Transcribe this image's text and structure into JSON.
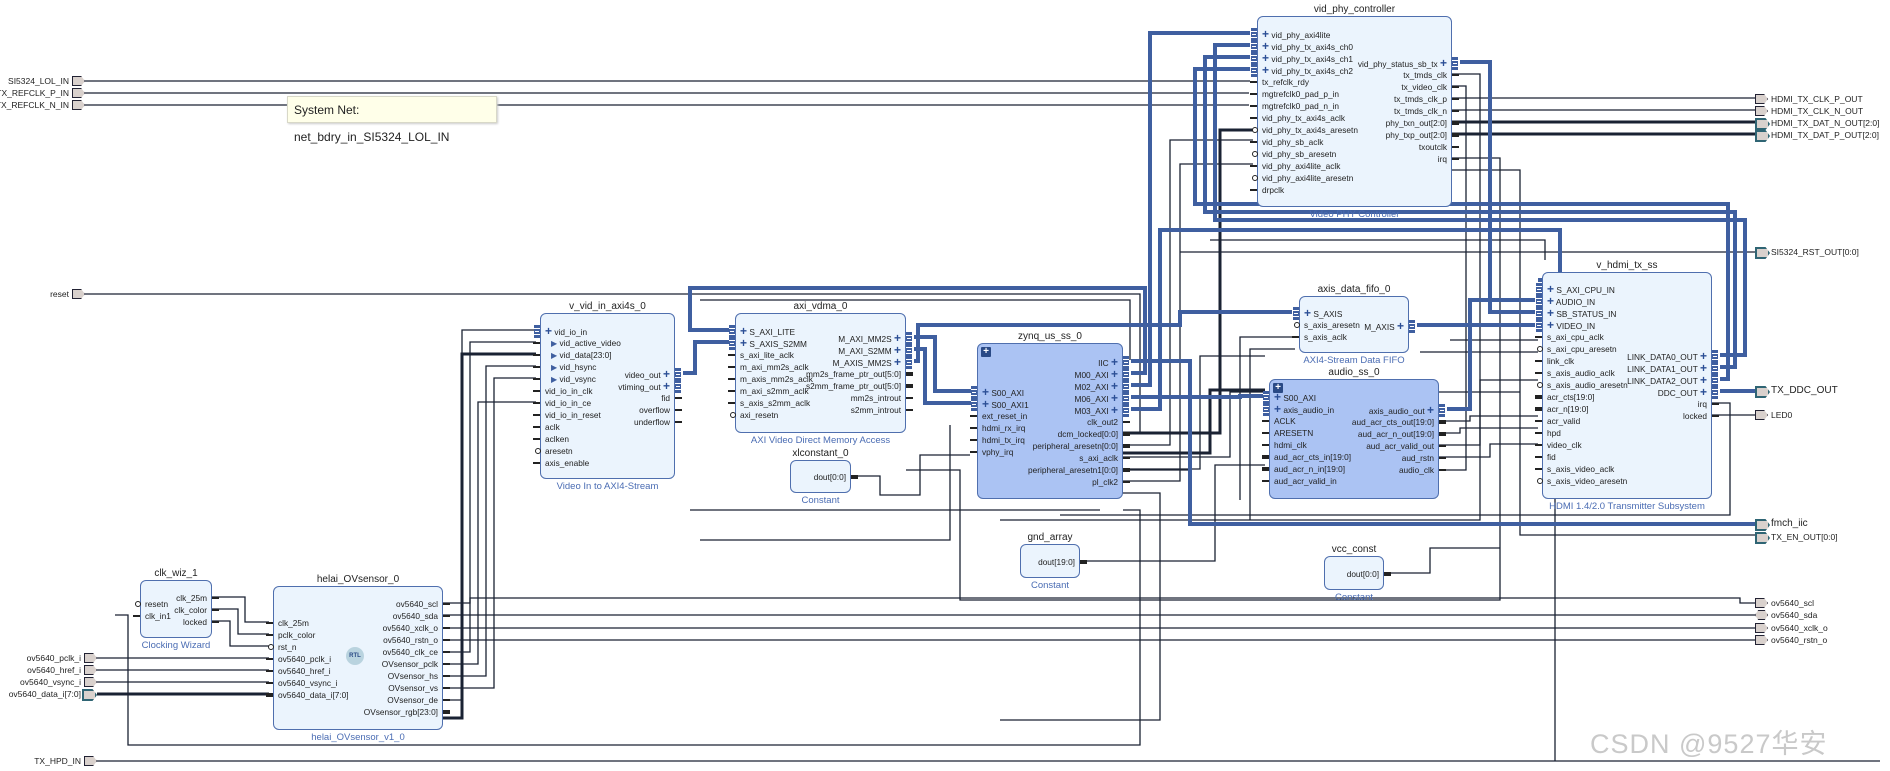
{
  "tooltip": "System Net: net_bdry_in_SI5324_LOL_IN",
  "watermark": "CSDN @9527华安",
  "colors": {
    "interface_wire": "#3f5fa0",
    "wire": "#1a2233",
    "block_fill": "#ebf4fd",
    "hier_fill": "#abc3f3",
    "subtitle": "#4a6cb3"
  },
  "ports_left": [
    {
      "label": "SI5324_LOL_IN",
      "kind": "wire"
    },
    {
      "label": "TX_REFCLK_P_IN",
      "kind": "wire"
    },
    {
      "label": "TX_REFCLK_N_IN",
      "kind": "wire"
    },
    {
      "label": "reset",
      "kind": "wire"
    },
    {
      "label": "ov5640_pclk_i",
      "kind": "wire"
    },
    {
      "label": "ov5640_href_i",
      "kind": "wire"
    },
    {
      "label": "ov5640_vsync_i",
      "kind": "wire"
    },
    {
      "label": "ov5640_data_i[7:0]",
      "kind": "bus"
    },
    {
      "label": "TX_HPD_IN",
      "kind": "wire"
    }
  ],
  "ports_right": [
    {
      "label": "HDMI_TX_CLK_P_OUT",
      "kind": "wire"
    },
    {
      "label": "HDMI_TX_CLK_N_OUT",
      "kind": "wire"
    },
    {
      "label": "HDMI_TX_DAT_N_OUT[2:0]",
      "kind": "bus"
    },
    {
      "label": "HDMI_TX_DAT_P_OUT[2:0]",
      "kind": "bus"
    },
    {
      "label": "SI5324_RST_OUT[0:0]",
      "kind": "bus"
    },
    {
      "label": "TX_DDC_OUT",
      "kind": "intf"
    },
    {
      "label": "LED0",
      "kind": "wire"
    },
    {
      "label": "fmch_iic",
      "kind": "intf"
    },
    {
      "label": "TX_EN_OUT[0:0]",
      "kind": "bus"
    },
    {
      "label": "ov5640_scl",
      "kind": "wire"
    },
    {
      "label": "ov5640_sda",
      "kind": "bidir"
    },
    {
      "label": "ov5640_xclk_o",
      "kind": "wire"
    },
    {
      "label": "ov5640_rstn_o",
      "kind": "wire"
    }
  ],
  "blocks": [
    {
      "id": "vphy",
      "title": "vid_phy_controller",
      "subtitle": "Video PHY Controller",
      "left": [
        [
          "vid_phy_axi4lite",
          "i"
        ],
        [
          "vid_phy_tx_axi4s_ch0",
          "i"
        ],
        [
          "vid_phy_tx_axi4s_ch1",
          "i"
        ],
        [
          "vid_phy_tx_axi4s_ch2",
          "i"
        ],
        [
          "tx_refclk_rdy",
          "w"
        ],
        [
          "mgtrefclk0_pad_p_in",
          "w"
        ],
        [
          "mgtrefclk0_pad_n_in",
          "w"
        ],
        [
          "vid_phy_tx_axi4s_aclk",
          "w"
        ],
        [
          "vid_phy_tx_axi4s_aresetn",
          "r"
        ],
        [
          "vid_phy_sb_aclk",
          "w"
        ],
        [
          "vid_phy_sb_aresetn",
          "r"
        ],
        [
          "vid_phy_axi4lite_aclk",
          "w"
        ],
        [
          "vid_phy_axi4lite_aresetn",
          "r"
        ],
        [
          "drpclk",
          "w"
        ]
      ],
      "right": [
        [
          "vid_phy_status_sb_tx",
          "i"
        ],
        [
          "tx_tmds_clk",
          "w"
        ],
        [
          "tx_video_clk",
          "w"
        ],
        [
          "tx_tmds_clk_p",
          "w"
        ],
        [
          "tx_tmds_clk_n",
          "w"
        ],
        [
          "phy_txn_out[2:0]",
          "b"
        ],
        [
          "phy_txp_out[2:0]",
          "b"
        ],
        [
          "txoutclk",
          "w"
        ],
        [
          "irq",
          "w"
        ]
      ]
    },
    {
      "id": "vin",
      "title": "v_vid_in_axi4s_0",
      "subtitle": "Video In to AXI4-Stream",
      "left": [
        [
          "vid_io_in",
          "i"
        ],
        [
          "vid_active_video",
          "s"
        ],
        [
          "vid_data[23:0]",
          "s"
        ],
        [
          "vid_hsync",
          "s"
        ],
        [
          "vid_vsync",
          "s"
        ],
        [
          "vid_io_in_clk",
          "w"
        ],
        [
          "vid_io_in_ce",
          "w"
        ],
        [
          "vid_io_in_reset",
          "w"
        ],
        [
          "aclk",
          "w"
        ],
        [
          "aclken",
          "w"
        ],
        [
          "aresetn",
          "r"
        ],
        [
          "axis_enable",
          "w"
        ]
      ],
      "right": [
        [
          "video_out",
          "i"
        ],
        [
          "vtiming_out",
          "i"
        ],
        [
          "fid",
          "w"
        ],
        [
          "overflow",
          "w"
        ],
        [
          "underflow",
          "w"
        ]
      ]
    },
    {
      "id": "vdma",
      "title": "axi_vdma_0",
      "subtitle": "AXI Video Direct Memory Access",
      "left": [
        [
          "S_AXI_LITE",
          "i"
        ],
        [
          "S_AXIS_S2MM",
          "i"
        ],
        [
          "s_axi_lite_aclk",
          "w"
        ],
        [
          "m_axi_mm2s_aclk",
          "w"
        ],
        [
          "m_axis_mm2s_aclk",
          "w"
        ],
        [
          "m_axi_s2mm_aclk",
          "w"
        ],
        [
          "s_axis_s2mm_aclk",
          "w"
        ],
        [
          "axi_resetn",
          "r"
        ]
      ],
      "right": [
        [
          "M_AXI_MM2S",
          "i"
        ],
        [
          "M_AXI_S2MM",
          "i"
        ],
        [
          "M_AXIS_MM2S",
          "i"
        ],
        [
          "mm2s_frame_ptr_out[5:0]",
          "b"
        ],
        [
          "s2mm_frame_ptr_out[5:0]",
          "b"
        ],
        [
          "mm2s_introut",
          "w"
        ],
        [
          "s2mm_introut",
          "w"
        ]
      ]
    },
    {
      "id": "zynq",
      "title": "zynq_us_ss_0",
      "subtitle": "",
      "left": [
        [
          "S00_AXI",
          "i"
        ],
        [
          "S00_AXI1",
          "i"
        ],
        [
          "ext_reset_in",
          "w"
        ],
        [
          "hdmi_rx_irq",
          "w"
        ],
        [
          "hdmi_tx_irq",
          "w"
        ],
        [
          "vphy_irq",
          "w"
        ]
      ],
      "right": [
        [
          "IIC",
          "i"
        ],
        [
          "M00_AXI",
          "i"
        ],
        [
          "M02_AXI",
          "i"
        ],
        [
          "M06_AXI",
          "i"
        ],
        [
          "M03_AXI",
          "i"
        ],
        [
          "clk_out2",
          "w"
        ],
        [
          "dcm_locked[0:0]",
          "b"
        ],
        [
          "peripheral_aresetn[0:0]",
          "b"
        ],
        [
          "s_axi_aclk",
          "w"
        ],
        [
          "peripheral_aresetn1[0:0]",
          "b"
        ],
        [
          "pl_clk2",
          "w"
        ]
      ]
    },
    {
      "id": "audio",
      "title": "audio_ss_0",
      "subtitle": "",
      "left": [
        [
          "S00_AXI",
          "i"
        ],
        [
          "axis_audio_in",
          "i"
        ],
        [
          "ACLK",
          "w"
        ],
        [
          "ARESETN",
          "w"
        ],
        [
          "hdmi_clk",
          "w"
        ],
        [
          "aud_acr_cts_in[19:0]",
          "b"
        ],
        [
          "aud_acr_n_in[19:0]",
          "b"
        ],
        [
          "aud_acr_valid_in",
          "w"
        ]
      ],
      "right": [
        [
          "axis_audio_out",
          "i"
        ],
        [
          "aud_acr_cts_out[19:0]",
          "b"
        ],
        [
          "aud_acr_n_out[19:0]",
          "b"
        ],
        [
          "aud_acr_valid_out",
          "w"
        ],
        [
          "aud_rstn",
          "w"
        ],
        [
          "audio_clk",
          "w"
        ]
      ]
    },
    {
      "id": "fifo",
      "title": "axis_data_fifo_0",
      "subtitle": "AXI4-Stream Data FIFO",
      "left": [
        [
          "S_AXIS",
          "i"
        ],
        [
          "s_axis_aresetn",
          "r"
        ],
        [
          "s_axis_aclk",
          "w"
        ]
      ],
      "right": [
        [
          "M_AXIS",
          "i"
        ]
      ]
    },
    {
      "id": "hdmi",
      "title": "v_hdmi_tx_ss",
      "subtitle": "HDMI 1.4/2.0 Transmitter Subsystem",
      "left": [
        [
          "S_AXI_CPU_IN",
          "i"
        ],
        [
          "AUDIO_IN",
          "i"
        ],
        [
          "SB_STATUS_IN",
          "i"
        ],
        [
          "VIDEO_IN",
          "i"
        ],
        [
          "s_axi_cpu_aclk",
          "w"
        ],
        [
          "s_axi_cpu_aresetn",
          "r"
        ],
        [
          "link_clk",
          "w"
        ],
        [
          "s_axis_audio_aclk",
          "w"
        ],
        [
          "s_axis_audio_aresetn",
          "r"
        ],
        [
          "acr_cts[19:0]",
          "b"
        ],
        [
          "acr_n[19:0]",
          "b"
        ],
        [
          "acr_valid",
          "w"
        ],
        [
          "hpd",
          "w"
        ],
        [
          "video_clk",
          "w"
        ],
        [
          "fid",
          "w"
        ],
        [
          "s_axis_video_aclk",
          "w"
        ],
        [
          "s_axis_video_aresetn",
          "r"
        ]
      ],
      "right": [
        [
          "LINK_DATA0_OUT",
          "i"
        ],
        [
          "LINK_DATA1_OUT",
          "i"
        ],
        [
          "LINK_DATA2_OUT",
          "i"
        ],
        [
          "DDC_OUT",
          "i"
        ],
        [
          "irq",
          "w"
        ],
        [
          "locked",
          "w"
        ]
      ]
    },
    {
      "id": "clkwiz",
      "title": "clk_wiz_1",
      "subtitle": "Clocking Wizard",
      "left": [
        [
          "resetn",
          "r"
        ],
        [
          "clk_in1",
          "w"
        ]
      ],
      "right": [
        [
          "clk_25m",
          "w"
        ],
        [
          "clk_color",
          "w"
        ],
        [
          "locked",
          "w"
        ]
      ]
    },
    {
      "id": "ov",
      "title": "helai_OVsensor_0",
      "subtitle": "helai_OVsensor_v1_0",
      "badge": "RTL",
      "left": [
        [
          "clk_25m",
          "w"
        ],
        [
          "pclk_color",
          "w"
        ],
        [
          "rst_n",
          "r"
        ],
        [
          "ov5640_pclk_i",
          "w"
        ],
        [
          "ov5640_href_i",
          "w"
        ],
        [
          "ov5640_vsync_i",
          "w"
        ],
        [
          "ov5640_data_i[7:0]",
          "b"
        ]
      ],
      "right": [
        [
          "ov5640_scl",
          "w"
        ],
        [
          "ov5640_sda",
          "w"
        ],
        [
          "ov5640_xclk_o",
          "w"
        ],
        [
          "ov5640_rstn_o",
          "w"
        ],
        [
          "ov5640_clk_ce",
          "w"
        ],
        [
          "OVsensor_pclk",
          "w"
        ],
        [
          "OVsensor_hs",
          "w"
        ],
        [
          "OVsensor_vs",
          "w"
        ],
        [
          "OVsensor_de",
          "w"
        ],
        [
          "OVsensor_rgb[23:0]",
          "b"
        ]
      ]
    },
    {
      "id": "xlc",
      "title": "xlconstant_0",
      "subtitle": "Constant",
      "left": [],
      "right": [
        [
          "dout[0:0]",
          "b"
        ]
      ]
    },
    {
      "id": "gnd",
      "title": "gnd_array",
      "subtitle": "Constant",
      "left": [],
      "right": [
        [
          "dout[19:0]",
          "b"
        ]
      ]
    },
    {
      "id": "vcc",
      "title": "vcc_const",
      "subtitle": "Constant",
      "left": [],
      "right": [
        [
          "dout[0:0]",
          "b"
        ]
      ]
    }
  ]
}
